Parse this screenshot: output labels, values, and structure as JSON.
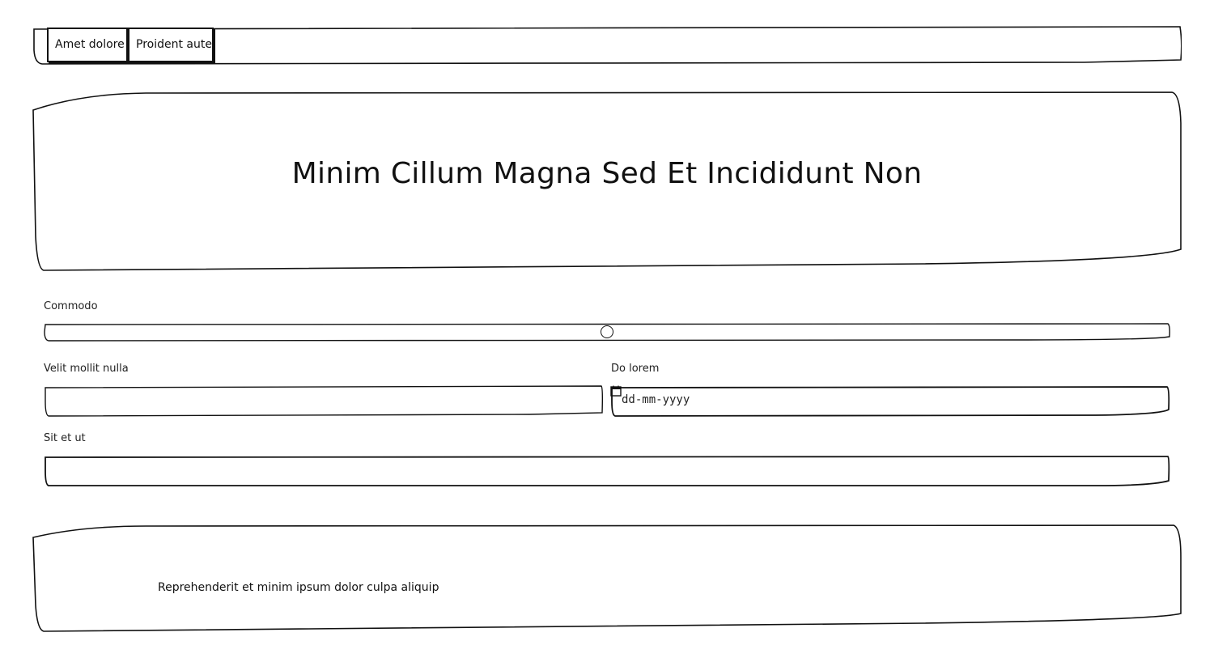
{
  "nav": {
    "tabs": [
      {
        "label": "Amet dolore"
      },
      {
        "label": "Proident aute"
      }
    ]
  },
  "hero": {
    "title": "Minim Cillum Magna Sed Et Incididunt Non"
  },
  "form": {
    "slider": {
      "label": "Commodo",
      "value": 0.5
    },
    "text_field_1": {
      "label": "Velit mollit nulla",
      "value": ""
    },
    "date_field": {
      "label": "Do lorem",
      "placeholder": "dd-mm-yyyy",
      "icon": "calendar-icon"
    },
    "text_field_2": {
      "label": "Sit et ut",
      "value": ""
    }
  },
  "footer": {
    "text": "Reprehenderit et minim ipsum dolor culpa aliquip"
  }
}
